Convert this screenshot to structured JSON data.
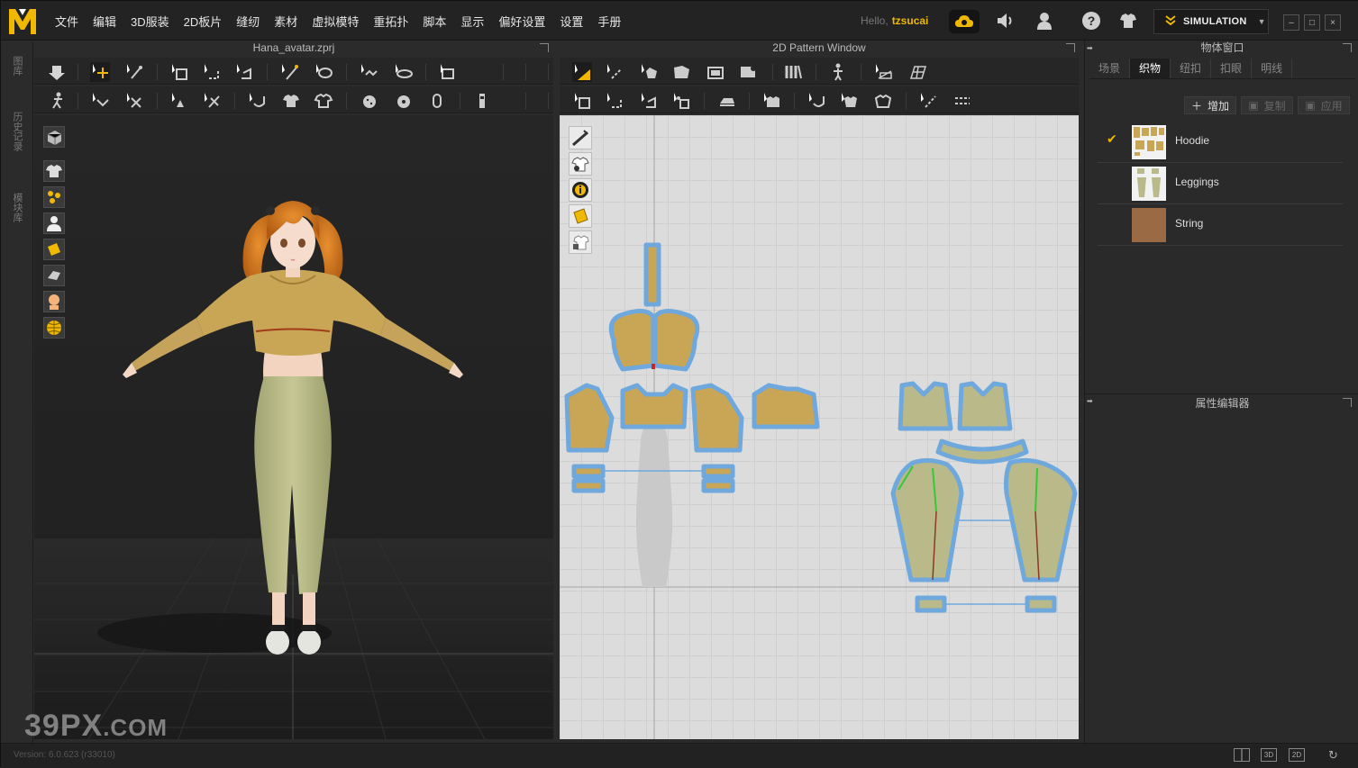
{
  "menu": {
    "items": [
      "文件",
      "编辑",
      "3D服装",
      "2D板片",
      "缝纫",
      "素材",
      "虚拟模特",
      "重拓扑",
      "脚本",
      "显示",
      "偏好设置",
      "设置",
      "手册"
    ]
  },
  "account": {
    "hello": "Hello,",
    "username": "tzsucai"
  },
  "simulation": {
    "label": "SIMULATION"
  },
  "window_buttons": {
    "minimize": "–",
    "maximize": "□",
    "close": "×"
  },
  "side_tabs": [
    "图库",
    "历史记录",
    "模块库"
  ],
  "panels": {
    "viewport3d_title": "Hana_avatar.zprj",
    "pattern2d_title": "2D Pattern Window",
    "object_browser_title": "物体窗口",
    "property_editor_title": "属性编辑器"
  },
  "object_browser": {
    "tabs": [
      "场景",
      "织物",
      "纽扣",
      "扣眼",
      "明线"
    ],
    "active_tab": "织物",
    "buttons": {
      "add": "增加",
      "copy": "复制",
      "apply": "应用"
    },
    "fabrics": [
      {
        "name": "Hoodie",
        "checked": true,
        "swatch": "hoodie"
      },
      {
        "name": "Leggings",
        "checked": false,
        "swatch": "leggings"
      },
      {
        "name": "String",
        "checked": false,
        "swatch": "string"
      }
    ]
  },
  "status": {
    "version": "Version: 6.0.623 (r33010)",
    "view_buttons": [
      "3D",
      "2D"
    ]
  },
  "watermark": {
    "main": "39PX",
    "suffix": ".COM"
  },
  "colors": {
    "accent": "#f0b800",
    "hoodie_fabric": "#c9a556",
    "leggings_fabric": "#b9b98a",
    "string_fabric": "#9a6a45",
    "pattern_outline": "#6fa8dc"
  }
}
